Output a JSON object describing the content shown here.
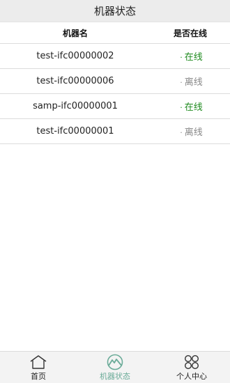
{
  "header": {
    "title": "机器状态"
  },
  "table": {
    "columns": [
      "机器名",
      "是否在线"
    ],
    "rows": [
      {
        "name": "test-ifc00000002",
        "status": "在线",
        "status_key": "online"
      },
      {
        "name": "test-ifc00000006",
        "status": "离线",
        "status_key": "offline"
      },
      {
        "name": "samp-ifc00000001",
        "status": "在线",
        "status_key": "online"
      },
      {
        "name": "test-ifc00000001",
        "status": "离线",
        "status_key": "offline"
      }
    ]
  },
  "tabbar": {
    "tabs": [
      {
        "label": "首页",
        "icon": "home-icon",
        "active": false
      },
      {
        "label": "机器状态",
        "icon": "machine-status-icon",
        "active": true
      },
      {
        "label": "个人中心",
        "icon": "personal-center-icon",
        "active": false
      }
    ]
  },
  "colors": {
    "online": "#1e8a1e",
    "offline": "#888888",
    "active_tab": "#6aab98"
  }
}
